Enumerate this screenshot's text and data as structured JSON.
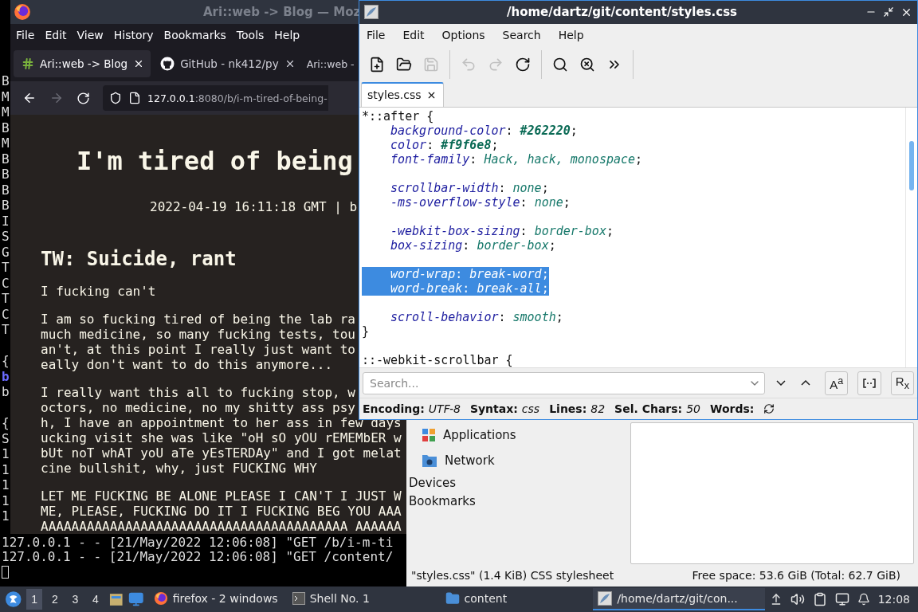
{
  "terminal": {
    "left_column": [
      [
        {
          "text": "B",
          "highlighted": false
        },
        {
          "text": "M",
          "highlighted": false
        },
        {
          "text": "M",
          "highlighted": false
        },
        {
          "text": "B",
          "highlighted": false
        },
        {
          "text": "M",
          "highlighted": false
        },
        {
          "text": "B",
          "highlighted": false
        },
        {
          "text": "B",
          "highlighted": false
        },
        {
          "text": "B",
          "highlighted": false
        },
        {
          "text": "B",
          "highlighted": false
        },
        {
          "text": "I",
          "highlighted": false
        },
        {
          "text": "S",
          "highlighted": false
        },
        {
          "text": "G",
          "highlighted": false
        },
        {
          "text": "T",
          "highlighted": false
        },
        {
          "text": "C",
          "highlighted": false
        },
        {
          "text": "T",
          "highlighted": false
        },
        {
          "text": "C",
          "highlighted": false
        },
        {
          "text": "T",
          "highlighted": false
        }
      ],
      [
        {
          "text": "{",
          "highlighted": false
        },
        {
          "text": "b",
          "highlighted": true
        },
        {
          "text": "b",
          "highlighted": false
        }
      ],
      [
        {
          "text": "{",
          "highlighted": false
        },
        {
          "text": "S",
          "highlighted": false
        },
        {
          "text": "1",
          "highlighted": false
        },
        {
          "text": "1",
          "highlighted": false
        },
        {
          "text": "1",
          "highlighted": false
        },
        {
          "text": "1",
          "highlighted": false
        },
        {
          "text": "1",
          "highlighted": false
        }
      ]
    ],
    "lines": [
      "127.0.0.1 - - [21/May/2022 12:06:08] \"GET /b/i-m-ti",
      "127.0.0.1 - - [21/May/2022 12:06:08] \"GET /content/"
    ]
  },
  "browser": {
    "title": "Ari::web -> Blog — Moz",
    "menu": [
      "File",
      "Edit",
      "View",
      "History",
      "Bookmarks",
      "Tools",
      "Help"
    ],
    "tabs": [
      {
        "label": "Ari::web -> Blog",
        "kind": "hash",
        "selected": true
      },
      {
        "label": "GitHub - nk412/py",
        "kind": "github",
        "selected": false
      },
      {
        "label": "Ari::web -",
        "kind": "none",
        "selected": false
      }
    ],
    "url": {
      "host": "127.0.0.1",
      "path": ":8080/b/i-m-tired-of-being-"
    },
    "page": {
      "title": "I'm tired of being",
      "meta": "2022-04-19 16:11:18 GMT | b",
      "heading": "TW: Suicide, rant",
      "paragraphs": [
        [
          "I fucking can't"
        ],
        [
          "I am so fucking tired of being the lab ra",
          "much medicine, so many fucking tests, tou",
          "an't, at this point I really just want to",
          "eally don't want to do this anymore..."
        ],
        [
          "I really want this all to fucking stop, w",
          "octors, no medicine, no my shitty ass psy",
          "h, I have an appointment to her ass in few days",
          "ucking visit she was like \"oH sO yOU rEMEMbER w",
          "bUt noT whAT yoU aTe yEsTERDAy\" and I got melat",
          "cine bullshit, why, just FUCKING WHY"
        ],
        [
          "LET ME FUCKING BE ALONE PLEASE I CAN'T I JUST W",
          "ME, PLEASE, FUCKING DO IT I FUCKING BEG YOU AAA",
          "AAAAAAAAAAAAAAAAAAAAAAAAAAAAAAAAAAAAAAAA AAAAAA"
        ]
      ]
    }
  },
  "editor": {
    "title": "/home/dartz/git/content/styles.css",
    "menu": [
      "File",
      "Edit",
      "Options",
      "Search",
      "Help"
    ],
    "toolbar": [
      [
        {
          "kind": "new",
          "disabled": false
        },
        {
          "kind": "open",
          "disabled": false
        },
        {
          "kind": "save",
          "disabled": true
        }
      ],
      [
        {
          "kind": "undo",
          "disabled": true
        },
        {
          "kind": "redo",
          "disabled": true
        },
        {
          "kind": "reload",
          "disabled": false
        }
      ],
      [
        {
          "kind": "find",
          "disabled": false
        },
        {
          "kind": "replace",
          "disabled": false
        },
        {
          "kind": "more",
          "disabled": false
        }
      ]
    ],
    "tab": {
      "label": "styles.css",
      "selected": true
    },
    "code": [
      {
        "kind": "selector",
        "selected": false,
        "segments": [
          {
            "kind": "plain",
            "text": "*::after {"
          }
        ]
      },
      {
        "kind": "declaration",
        "selected": false,
        "segments": [
          {
            "kind": "prop",
            "text": "background-color"
          },
          {
            "kind": "plain",
            "text": ": "
          },
          {
            "kind": "color",
            "text": "#262220"
          },
          {
            "kind": "plain",
            "text": ";"
          }
        ]
      },
      {
        "kind": "declaration",
        "selected": false,
        "segments": [
          {
            "kind": "prop",
            "text": "color"
          },
          {
            "kind": "plain",
            "text": ": "
          },
          {
            "kind": "color",
            "text": "#f9f6e8"
          },
          {
            "kind": "plain",
            "text": ";"
          }
        ]
      },
      {
        "kind": "declaration",
        "selected": false,
        "segments": [
          {
            "kind": "prop",
            "text": "font-family"
          },
          {
            "kind": "plain",
            "text": ": "
          },
          {
            "kind": "value",
            "text": "Hack, hack, monospace"
          },
          {
            "kind": "plain",
            "text": ";"
          }
        ]
      },
      {
        "kind": "blank",
        "selected": false
      },
      {
        "kind": "declaration",
        "selected": false,
        "segments": [
          {
            "kind": "prop",
            "text": "scrollbar-width"
          },
          {
            "kind": "plain",
            "text": ": "
          },
          {
            "kind": "value",
            "text": "none"
          },
          {
            "kind": "plain",
            "text": ";"
          }
        ]
      },
      {
        "kind": "declaration",
        "selected": false,
        "segments": [
          {
            "kind": "prop",
            "text": "-ms-overflow-style"
          },
          {
            "kind": "plain",
            "text": ": "
          },
          {
            "kind": "value",
            "text": "none"
          },
          {
            "kind": "plain",
            "text": ";"
          }
        ]
      },
      {
        "kind": "blank",
        "selected": false
      },
      {
        "kind": "declaration",
        "selected": false,
        "segments": [
          {
            "kind": "prop",
            "text": "-webkit-box-sizing"
          },
          {
            "kind": "plain",
            "text": ": "
          },
          {
            "kind": "value",
            "text": "border-box"
          },
          {
            "kind": "plain",
            "text": ";"
          }
        ]
      },
      {
        "kind": "declaration",
        "selected": false,
        "segments": [
          {
            "kind": "prop",
            "text": "box-sizing"
          },
          {
            "kind": "plain",
            "text": ": "
          },
          {
            "kind": "value",
            "text": "border-box"
          },
          {
            "kind": "plain",
            "text": ";"
          }
        ]
      },
      {
        "kind": "blank",
        "selected": false
      },
      {
        "kind": "declaration",
        "selected": true,
        "segments": [
          {
            "kind": "prop",
            "text": "word-wrap"
          },
          {
            "kind": "plain",
            "text": ": "
          },
          {
            "kind": "value",
            "text": "break-word"
          },
          {
            "kind": "plain",
            "text": ";"
          }
        ]
      },
      {
        "kind": "declaration",
        "selected": true,
        "segments": [
          {
            "kind": "prop",
            "text": "word-break"
          },
          {
            "kind": "plain",
            "text": ": "
          },
          {
            "kind": "value",
            "text": "break-all"
          },
          {
            "kind": "plain",
            "text": ";"
          }
        ]
      },
      {
        "kind": "blank",
        "selected": false
      },
      {
        "kind": "declaration",
        "selected": false,
        "segments": [
          {
            "kind": "prop",
            "text": "scroll-behavior"
          },
          {
            "kind": "plain",
            "text": ": "
          },
          {
            "kind": "value",
            "text": "smooth"
          },
          {
            "kind": "plain",
            "text": ";"
          }
        ]
      },
      {
        "kind": "selector",
        "selected": false,
        "segments": [
          {
            "kind": "plain",
            "text": "}"
          }
        ]
      },
      {
        "kind": "blank",
        "selected": false
      },
      {
        "kind": "selector",
        "selected": false,
        "segments": [
          {
            "kind": "plain",
            "text": "::-webkit-scrollbar {"
          }
        ]
      }
    ],
    "search": {
      "placeholder": "Search...",
      "toggles": [
        {
          "kind": "text",
          "label": "A$^{a}$"
        },
        {
          "kind": "icon"
        },
        {
          "kind": "text",
          "label": "R$_{x}$"
        }
      ]
    },
    "status": [
      {
        "label": "Encoding:",
        "value": "UTF-8"
      },
      {
        "label": "Syntax:",
        "value": "css"
      },
      {
        "label": "Lines:",
        "value": "82"
      },
      {
        "label": "Sel. Chars:",
        "value": "50"
      },
      {
        "label": "Words:"
      }
    ]
  },
  "file_manager": {
    "places": [
      {
        "label": "Applications",
        "kind": "apps"
      },
      {
        "label": "Network",
        "kind": "network"
      }
    ],
    "sections": [
      "Devices",
      "Bookmarks"
    ],
    "status_left": "\"styles.css\" (1.4 KiB) CSS stylesheet",
    "status_right": "Free space: 53.6 GiB (Total: 62.7 GiB)"
  },
  "taskbar": {
    "workspaces": [
      {
        "label": "1",
        "selected": true
      },
      {
        "label": "2",
        "selected": false
      },
      {
        "label": "3",
        "selected": false
      },
      {
        "label": "4",
        "selected": false
      }
    ],
    "tasks": [
      {
        "label": "firefox - 2 windows",
        "kind": "firefox",
        "selected": false
      },
      {
        "label": "Shell No. 1",
        "kind": "terminal",
        "selected": false
      },
      {
        "label": "content",
        "kind": "folder",
        "selected": false
      },
      {
        "label": "/home/dartz/git/con...",
        "kind": "editor",
        "selected": true
      }
    ],
    "clock": "12:08"
  }
}
